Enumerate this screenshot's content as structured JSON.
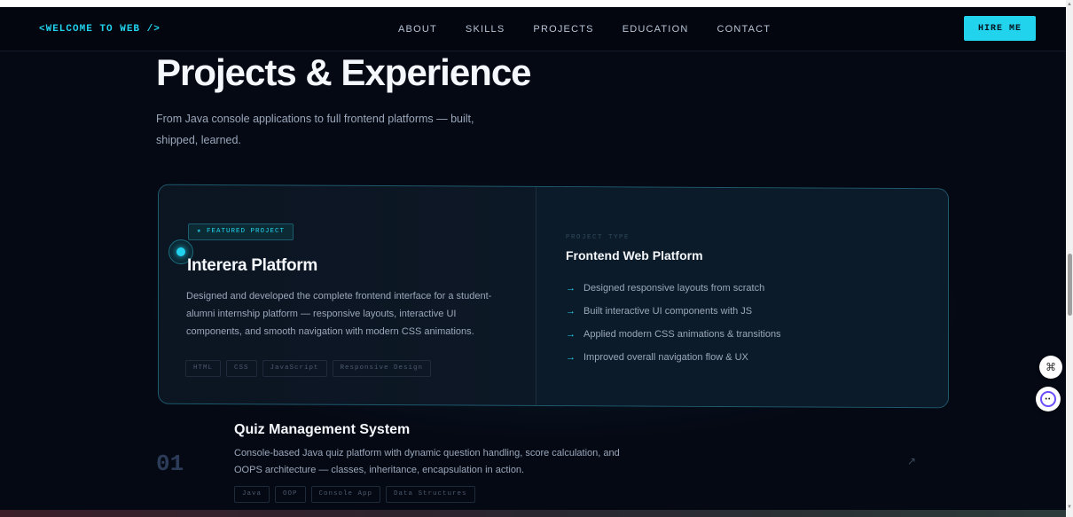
{
  "nav": {
    "logo": "<WELCOME TO WEB />",
    "links": [
      "ABOUT",
      "SKILLS",
      "PROJECTS",
      "EDUCATION",
      "CONTACT"
    ],
    "cta": "HIRE ME"
  },
  "hero": {
    "title": "Projects & Experience",
    "subtitle": "From Java console applications to full frontend platforms — built, shipped, learned."
  },
  "featured": {
    "badge": "★ FEATURED PROJECT",
    "title": "Interera Platform",
    "description": "Designed and developed the complete frontend interface for a student-alumni internship platform — responsive layouts, interactive UI components, and smooth navigation with modern CSS animations.",
    "tags": [
      "HTML",
      "CSS",
      "JavaScript",
      "Responsive Design"
    ],
    "type_label": "PROJECT TYPE",
    "type_value": "Frontend Web Platform",
    "bullets": [
      "Designed responsive layouts from scratch",
      "Built interactive UI components with JS",
      "Applied modern CSS animations & transitions",
      "Improved overall navigation flow & UX"
    ],
    "bullet_arrow": "→"
  },
  "projects": [
    {
      "number": "01",
      "title": "Quiz Management System",
      "description": "Console-based Java quiz platform with dynamic question handling, score calculation, and OOPS architecture — classes, inheritance, encapsulation in action.",
      "tags": [
        "Java",
        "OOP",
        "Console App",
        "Data Structures"
      ],
      "link_icon": "↗"
    }
  ],
  "widgets": {
    "apps_icon": "⌘",
    "assistant_eyes": "••"
  },
  "colors": {
    "accent": "#22d3ee",
    "background": "#050914"
  }
}
